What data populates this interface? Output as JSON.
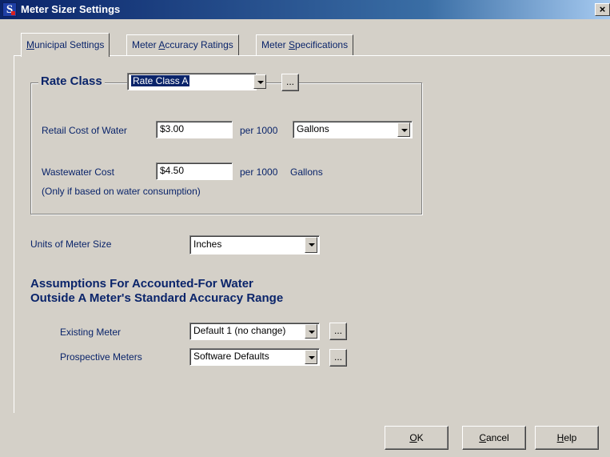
{
  "window": {
    "title": "Meter Sizer Settings",
    "app_icon_letter": "S",
    "close_glyph": "×"
  },
  "tabs": [
    {
      "label_pre": "",
      "mnemonic": "M",
      "label_post": "unicipal Settings",
      "active": true
    },
    {
      "label_pre": "Meter ",
      "mnemonic": "A",
      "label_post": "ccuracy Ratings",
      "active": false
    },
    {
      "label_pre": "Meter ",
      "mnemonic": "S",
      "label_post": "pecifications",
      "active": false
    }
  ],
  "rate_class": {
    "label": "Rate Class",
    "selected": "Rate Class A",
    "ellipsis": "..."
  },
  "retail_cost": {
    "label": "Retail Cost of Water",
    "value": "$3.00",
    "per_label": "per 1000",
    "unit_selected": "Gallons"
  },
  "wastewater": {
    "label": "Wastewater Cost",
    "note": "(Only if based on water consumption)",
    "value": "$4.50",
    "per_label": "per 1000",
    "unit": "Gallons"
  },
  "meter_size_units": {
    "label": "Units of Meter Size",
    "selected": "Inches"
  },
  "assumptions": {
    "heading_line1": "Assumptions For Accounted-For Water",
    "heading_line2": "Outside A Meter's Standard Accuracy Range",
    "existing": {
      "label": "Existing Meter",
      "selected": "Default 1 (no change)",
      "ellipsis": "..."
    },
    "prospective": {
      "label": "Prospective Meters",
      "selected": "Software Defaults",
      "ellipsis": "..."
    }
  },
  "buttons": {
    "ok": {
      "pre": "",
      "mnemonic": "O",
      "post": "K"
    },
    "cancel": {
      "pre": "",
      "mnemonic": "C",
      "post": "ancel"
    },
    "help": {
      "pre": "",
      "mnemonic": "H",
      "post": "elp"
    }
  },
  "colors": {
    "title_gradient_start": "#0a246a",
    "dialog_face": "#d4d0c8",
    "label_text": "#0a246a"
  }
}
